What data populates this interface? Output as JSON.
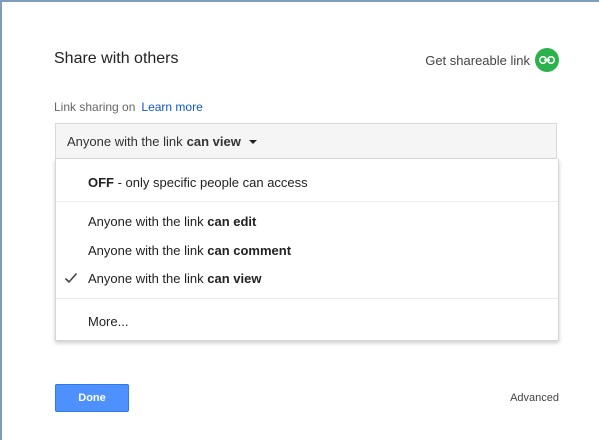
{
  "dialog": {
    "title": "Share with others",
    "get_link_label": "Get shareable link",
    "get_link_icon": "link-icon",
    "link_icon_color": "#2bb24c"
  },
  "sharing": {
    "status_label": "Link sharing on",
    "learn_more": "Learn more"
  },
  "dropdown": {
    "prefix": "Anyone with the link",
    "selected_bold": "can view"
  },
  "menu": {
    "off_bold": "OFF",
    "off_rest": " - only specific people can access",
    "items": [
      {
        "prefix": "Anyone with the link ",
        "bold": "can edit",
        "checked": false
      },
      {
        "prefix": "Anyone with the link ",
        "bold": "can comment",
        "checked": false
      },
      {
        "prefix": "Anyone with the link ",
        "bold": "can view",
        "checked": true
      }
    ],
    "more": "More..."
  },
  "footer": {
    "done_label": "Done",
    "advanced_label": "Advanced",
    "accent_color": "#4d90fe"
  }
}
